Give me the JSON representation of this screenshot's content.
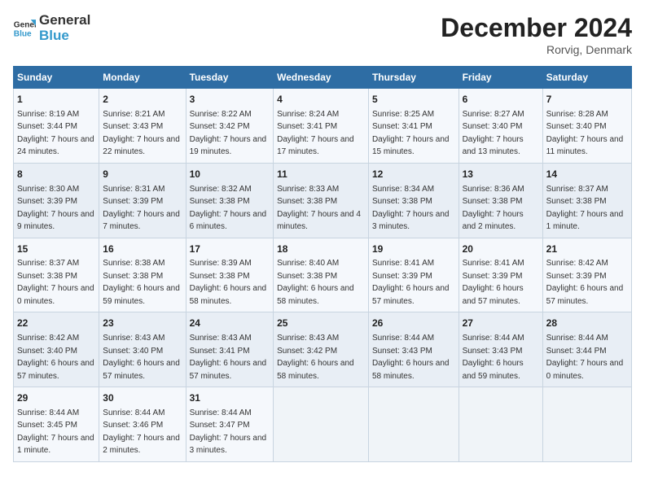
{
  "logo": {
    "text_general": "General",
    "text_blue": "Blue"
  },
  "title": "December 2024",
  "subtitle": "Rorvig, Denmark",
  "days_header": [
    "Sunday",
    "Monday",
    "Tuesday",
    "Wednesday",
    "Thursday",
    "Friday",
    "Saturday"
  ],
  "weeks": [
    [
      {
        "day": "1",
        "sunrise": "Sunrise: 8:19 AM",
        "sunset": "Sunset: 3:44 PM",
        "daylight": "Daylight: 7 hours and 24 minutes."
      },
      {
        "day": "2",
        "sunrise": "Sunrise: 8:21 AM",
        "sunset": "Sunset: 3:43 PM",
        "daylight": "Daylight: 7 hours and 22 minutes."
      },
      {
        "day": "3",
        "sunrise": "Sunrise: 8:22 AM",
        "sunset": "Sunset: 3:42 PM",
        "daylight": "Daylight: 7 hours and 19 minutes."
      },
      {
        "day": "4",
        "sunrise": "Sunrise: 8:24 AM",
        "sunset": "Sunset: 3:41 PM",
        "daylight": "Daylight: 7 hours and 17 minutes."
      },
      {
        "day": "5",
        "sunrise": "Sunrise: 8:25 AM",
        "sunset": "Sunset: 3:41 PM",
        "daylight": "Daylight: 7 hours and 15 minutes."
      },
      {
        "day": "6",
        "sunrise": "Sunrise: 8:27 AM",
        "sunset": "Sunset: 3:40 PM",
        "daylight": "Daylight: 7 hours and 13 minutes."
      },
      {
        "day": "7",
        "sunrise": "Sunrise: 8:28 AM",
        "sunset": "Sunset: 3:40 PM",
        "daylight": "Daylight: 7 hours and 11 minutes."
      }
    ],
    [
      {
        "day": "8",
        "sunrise": "Sunrise: 8:30 AM",
        "sunset": "Sunset: 3:39 PM",
        "daylight": "Daylight: 7 hours and 9 minutes."
      },
      {
        "day": "9",
        "sunrise": "Sunrise: 8:31 AM",
        "sunset": "Sunset: 3:39 PM",
        "daylight": "Daylight: 7 hours and 7 minutes."
      },
      {
        "day": "10",
        "sunrise": "Sunrise: 8:32 AM",
        "sunset": "Sunset: 3:38 PM",
        "daylight": "Daylight: 7 hours and 6 minutes."
      },
      {
        "day": "11",
        "sunrise": "Sunrise: 8:33 AM",
        "sunset": "Sunset: 3:38 PM",
        "daylight": "Daylight: 7 hours and 4 minutes."
      },
      {
        "day": "12",
        "sunrise": "Sunrise: 8:34 AM",
        "sunset": "Sunset: 3:38 PM",
        "daylight": "Daylight: 7 hours and 3 minutes."
      },
      {
        "day": "13",
        "sunrise": "Sunrise: 8:36 AM",
        "sunset": "Sunset: 3:38 PM",
        "daylight": "Daylight: 7 hours and 2 minutes."
      },
      {
        "day": "14",
        "sunrise": "Sunrise: 8:37 AM",
        "sunset": "Sunset: 3:38 PM",
        "daylight": "Daylight: 7 hours and 1 minute."
      }
    ],
    [
      {
        "day": "15",
        "sunrise": "Sunrise: 8:37 AM",
        "sunset": "Sunset: 3:38 PM",
        "daylight": "Daylight: 7 hours and 0 minutes."
      },
      {
        "day": "16",
        "sunrise": "Sunrise: 8:38 AM",
        "sunset": "Sunset: 3:38 PM",
        "daylight": "Daylight: 6 hours and 59 minutes."
      },
      {
        "day": "17",
        "sunrise": "Sunrise: 8:39 AM",
        "sunset": "Sunset: 3:38 PM",
        "daylight": "Daylight: 6 hours and 58 minutes."
      },
      {
        "day": "18",
        "sunrise": "Sunrise: 8:40 AM",
        "sunset": "Sunset: 3:38 PM",
        "daylight": "Daylight: 6 hours and 58 minutes."
      },
      {
        "day": "19",
        "sunrise": "Sunrise: 8:41 AM",
        "sunset": "Sunset: 3:39 PM",
        "daylight": "Daylight: 6 hours and 57 minutes."
      },
      {
        "day": "20",
        "sunrise": "Sunrise: 8:41 AM",
        "sunset": "Sunset: 3:39 PM",
        "daylight": "Daylight: 6 hours and 57 minutes."
      },
      {
        "day": "21",
        "sunrise": "Sunrise: 8:42 AM",
        "sunset": "Sunset: 3:39 PM",
        "daylight": "Daylight: 6 hours and 57 minutes."
      }
    ],
    [
      {
        "day": "22",
        "sunrise": "Sunrise: 8:42 AM",
        "sunset": "Sunset: 3:40 PM",
        "daylight": "Daylight: 6 hours and 57 minutes."
      },
      {
        "day": "23",
        "sunrise": "Sunrise: 8:43 AM",
        "sunset": "Sunset: 3:40 PM",
        "daylight": "Daylight: 6 hours and 57 minutes."
      },
      {
        "day": "24",
        "sunrise": "Sunrise: 8:43 AM",
        "sunset": "Sunset: 3:41 PM",
        "daylight": "Daylight: 6 hours and 57 minutes."
      },
      {
        "day": "25",
        "sunrise": "Sunrise: 8:43 AM",
        "sunset": "Sunset: 3:42 PM",
        "daylight": "Daylight: 6 hours and 58 minutes."
      },
      {
        "day": "26",
        "sunrise": "Sunrise: 8:44 AM",
        "sunset": "Sunset: 3:43 PM",
        "daylight": "Daylight: 6 hours and 58 minutes."
      },
      {
        "day": "27",
        "sunrise": "Sunrise: 8:44 AM",
        "sunset": "Sunset: 3:43 PM",
        "daylight": "Daylight: 6 hours and 59 minutes."
      },
      {
        "day": "28",
        "sunrise": "Sunrise: 8:44 AM",
        "sunset": "Sunset: 3:44 PM",
        "daylight": "Daylight: 7 hours and 0 minutes."
      }
    ],
    [
      {
        "day": "29",
        "sunrise": "Sunrise: 8:44 AM",
        "sunset": "Sunset: 3:45 PM",
        "daylight": "Daylight: 7 hours and 1 minute."
      },
      {
        "day": "30",
        "sunrise": "Sunrise: 8:44 AM",
        "sunset": "Sunset: 3:46 PM",
        "daylight": "Daylight: 7 hours and 2 minutes."
      },
      {
        "day": "31",
        "sunrise": "Sunrise: 8:44 AM",
        "sunset": "Sunset: 3:47 PM",
        "daylight": "Daylight: 7 hours and 3 minutes."
      },
      null,
      null,
      null,
      null
    ]
  ]
}
